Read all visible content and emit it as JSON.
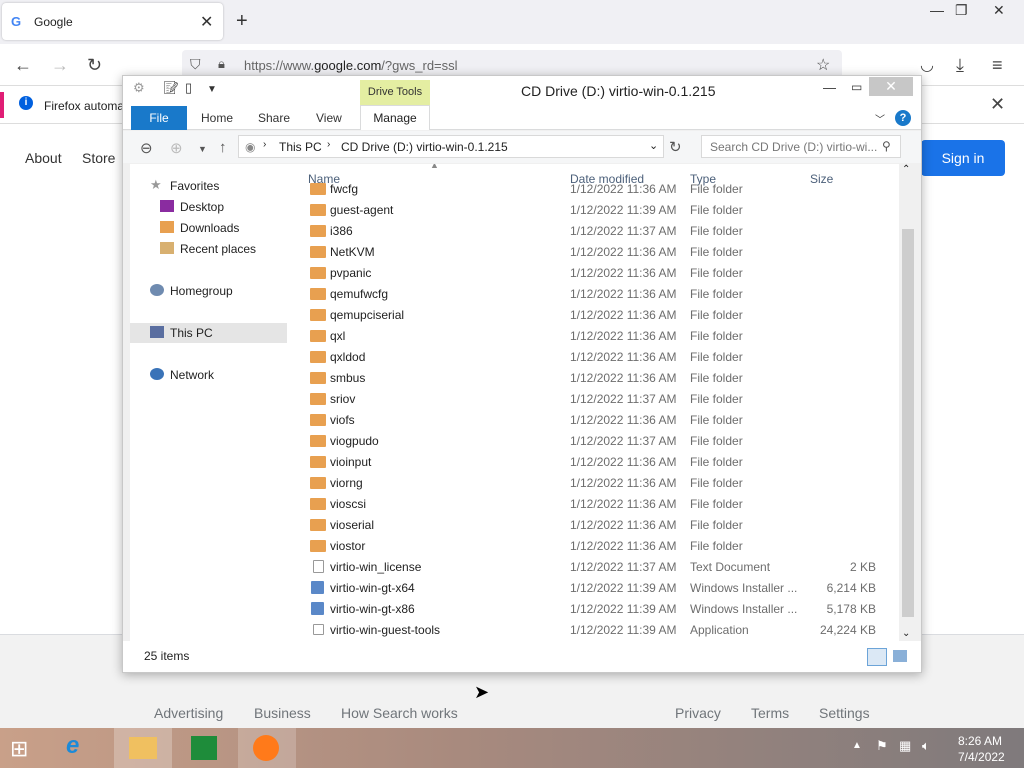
{
  "browser": {
    "tab_title": "Google",
    "tab_logo": "G",
    "url_prefix": "https://www.",
    "url_domain": "google.com",
    "url_suffix": "/?gws_rd=ssl",
    "infobar_text": "Firefox automa",
    "accent": "#0060df"
  },
  "google": {
    "about": "About",
    "store": "Store",
    "signin": "Sign in",
    "footer_left": [
      "Advertising",
      "Business",
      "How Search works"
    ],
    "footer_right": [
      "Privacy",
      "Terms",
      "Settings"
    ]
  },
  "explorer": {
    "title": "CD Drive (D:) virtio-win-0.1.215",
    "context_tab": "Drive Tools",
    "tabs": [
      "File",
      "Home",
      "Share",
      "View",
      "Manage"
    ],
    "breadcrumb": [
      "This PC",
      "CD Drive (D:) virtio-win-0.1.215"
    ],
    "search_placeholder": "Search CD Drive (D:) virtio-wi...",
    "nav": {
      "favorites": "Favorites",
      "desktop": "Desktop",
      "downloads": "Downloads",
      "recent": "Recent places",
      "homegroup": "Homegroup",
      "thispc": "This PC",
      "network": "Network"
    },
    "columns": [
      "Name",
      "Date modified",
      "Type",
      "Size"
    ],
    "files": [
      {
        "name": "fwcfg",
        "date": "1/12/2022 11:36 AM",
        "type": "File folder",
        "size": "",
        "icon": "folder"
      },
      {
        "name": "guest-agent",
        "date": "1/12/2022 11:39 AM",
        "type": "File folder",
        "size": "",
        "icon": "folder"
      },
      {
        "name": "i386",
        "date": "1/12/2022 11:37 AM",
        "type": "File folder",
        "size": "",
        "icon": "folder"
      },
      {
        "name": "NetKVM",
        "date": "1/12/2022 11:36 AM",
        "type": "File folder",
        "size": "",
        "icon": "folder"
      },
      {
        "name": "pvpanic",
        "date": "1/12/2022 11:36 AM",
        "type": "File folder",
        "size": "",
        "icon": "folder"
      },
      {
        "name": "qemufwcfg",
        "date": "1/12/2022 11:36 AM",
        "type": "File folder",
        "size": "",
        "icon": "folder"
      },
      {
        "name": "qemupciserial",
        "date": "1/12/2022 11:36 AM",
        "type": "File folder",
        "size": "",
        "icon": "folder"
      },
      {
        "name": "qxl",
        "date": "1/12/2022 11:36 AM",
        "type": "File folder",
        "size": "",
        "icon": "folder"
      },
      {
        "name": "qxldod",
        "date": "1/12/2022 11:36 AM",
        "type": "File folder",
        "size": "",
        "icon": "folder"
      },
      {
        "name": "smbus",
        "date": "1/12/2022 11:36 AM",
        "type": "File folder",
        "size": "",
        "icon": "folder"
      },
      {
        "name": "sriov",
        "date": "1/12/2022 11:37 AM",
        "type": "File folder",
        "size": "",
        "icon": "folder"
      },
      {
        "name": "viofs",
        "date": "1/12/2022 11:36 AM",
        "type": "File folder",
        "size": "",
        "icon": "folder"
      },
      {
        "name": "viogpudo",
        "date": "1/12/2022 11:37 AM",
        "type": "File folder",
        "size": "",
        "icon": "folder"
      },
      {
        "name": "vioinput",
        "date": "1/12/2022 11:36 AM",
        "type": "File folder",
        "size": "",
        "icon": "folder"
      },
      {
        "name": "viorng",
        "date": "1/12/2022 11:36 AM",
        "type": "File folder",
        "size": "",
        "icon": "folder"
      },
      {
        "name": "vioscsi",
        "date": "1/12/2022 11:36 AM",
        "type": "File folder",
        "size": "",
        "icon": "folder"
      },
      {
        "name": "vioserial",
        "date": "1/12/2022 11:36 AM",
        "type": "File folder",
        "size": "",
        "icon": "folder"
      },
      {
        "name": "viostor",
        "date": "1/12/2022 11:36 AM",
        "type": "File folder",
        "size": "",
        "icon": "folder"
      },
      {
        "name": "virtio-win_license",
        "date": "1/12/2022 11:37 AM",
        "type": "Text Document",
        "size": "2 KB",
        "icon": "doc"
      },
      {
        "name": "virtio-win-gt-x64",
        "date": "1/12/2022 11:39 AM",
        "type": "Windows Installer ...",
        "size": "6,214 KB",
        "icon": "msi"
      },
      {
        "name": "virtio-win-gt-x86",
        "date": "1/12/2022 11:39 AM",
        "type": "Windows Installer ...",
        "size": "5,178 KB",
        "icon": "msi"
      },
      {
        "name": "virtio-win-guest-tools",
        "date": "1/12/2022 11:39 AM",
        "type": "Application",
        "size": "24,224 KB",
        "icon": "app"
      }
    ],
    "status": "25 items"
  },
  "taskbar": {
    "time": "8:26 AM",
    "date": "7/4/2022"
  }
}
